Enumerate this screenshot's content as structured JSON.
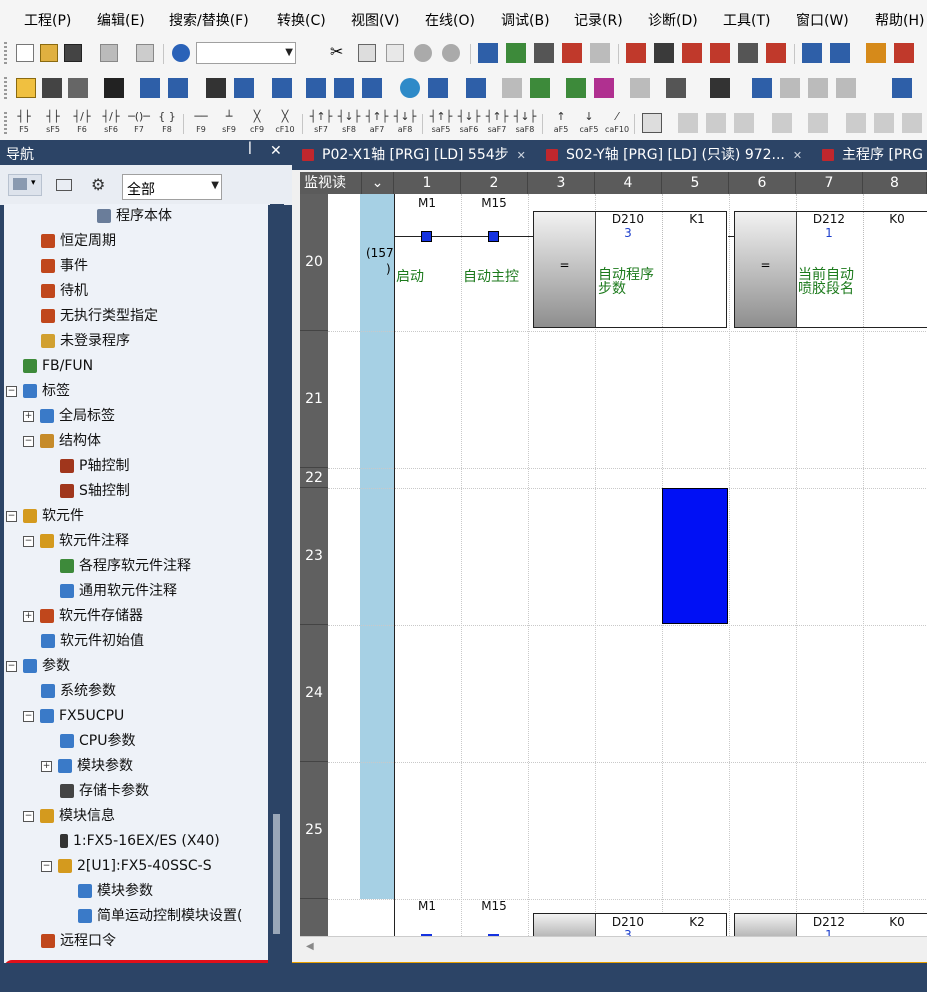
{
  "menu": [
    "工程(P)",
    "编辑(E)",
    "搜索/替换(F)",
    "转换(C)",
    "视图(V)",
    "在线(O)",
    "调试(B)",
    "记录(R)",
    "诊断(D)",
    "工具(T)",
    "窗口(W)",
    "帮助(H)"
  ],
  "fkeys": [
    {
      "sym": "┤├",
      "label": "F5"
    },
    {
      "sym": "┤├",
      "label": "sF5"
    },
    {
      "sym": "┤/├",
      "label": "F6"
    },
    {
      "sym": "┤/├",
      "label": "sF6"
    },
    {
      "sym": "─()─",
      "label": "F7"
    },
    {
      "sym": "{ }",
      "label": "F8"
    },
    {
      "sym": "──",
      "label": "F9"
    },
    {
      "sym": "┴",
      "label": "sF9"
    },
    {
      "sym": "╳",
      "label": "cF9"
    },
    {
      "sym": "╳",
      "label": "cF10"
    },
    {
      "sym": "┤↑├",
      "label": "sF7"
    },
    {
      "sym": "┤↓├",
      "label": "sF8"
    },
    {
      "sym": "┤↑├",
      "label": "aF7"
    },
    {
      "sym": "┤↓├",
      "label": "aF8"
    },
    {
      "sym": "┤↑├",
      "label": "saF5"
    },
    {
      "sym": "┤↓├",
      "label": "saF6"
    },
    {
      "sym": "┤↑├",
      "label": "saF7"
    },
    {
      "sym": "┤↓├",
      "label": "saF8"
    },
    {
      "sym": "↑",
      "label": "aF5"
    },
    {
      "sym": "↓",
      "label": "caF5"
    },
    {
      "sym": "⁄",
      "label": "caF10"
    }
  ],
  "nav": {
    "title": "导航",
    "pin": "ꟾ",
    "close": "✕",
    "filter": "全部",
    "items": [
      {
        "label": "程序本体",
        "exp": "",
        "color": "#6a7d9a"
      },
      {
        "label": "恒定周期",
        "exp": "",
        "color": "#c0471c"
      },
      {
        "label": "事件",
        "exp": "",
        "color": "#c0471c"
      },
      {
        "label": "待机",
        "exp": "",
        "color": "#c0471c"
      },
      {
        "label": "无执行类型指定",
        "exp": "",
        "color": "#c0471c"
      },
      {
        "label": "未登录程序",
        "exp": "",
        "color": "#d1a030"
      },
      {
        "label": "FB/FUN",
        "exp": "",
        "color": "#3d8a3a"
      },
      {
        "label": "标签",
        "exp": "−",
        "color": "#3a7ac8"
      },
      {
        "label": "全局标签",
        "exp": "+",
        "color": "#3a7ac8"
      },
      {
        "label": "结构体",
        "exp": "−",
        "color": "#c68b2a"
      },
      {
        "label": "P轴控制",
        "exp": "",
        "color": "#a0361c"
      },
      {
        "label": "S轴控制",
        "exp": "",
        "color": "#a0361c"
      },
      {
        "label": "软元件",
        "exp": "−",
        "color": "#d49a1e"
      },
      {
        "label": "软元件注释",
        "exp": "−",
        "color": "#d49a1e"
      },
      {
        "label": "各程序软元件注释",
        "exp": "",
        "color": "#3d8a3a"
      },
      {
        "label": "通用软元件注释",
        "exp": "",
        "color": "#3a7ac8"
      },
      {
        "label": "软元件存储器",
        "exp": "+",
        "color": "#c0471c"
      },
      {
        "label": "软元件初始值",
        "exp": "",
        "color": "#3a7ac8"
      },
      {
        "label": "参数",
        "exp": "−",
        "color": "#3a7ac8"
      },
      {
        "label": "系统参数",
        "exp": "",
        "color": "#3a7ac8"
      },
      {
        "label": "FX5UCPU",
        "exp": "−",
        "color": "#3a7ac8"
      },
      {
        "label": "CPU参数",
        "exp": "",
        "color": "#3a7ac8"
      },
      {
        "label": "模块参数",
        "exp": "+",
        "color": "#3a7ac8"
      },
      {
        "label": "存储卡参数",
        "exp": "",
        "color": "#444444"
      },
      {
        "label": "模块信息",
        "exp": "−",
        "color": "#d49a1e"
      },
      {
        "label": "1:FX5-16EX/ES  (X40)",
        "exp": "",
        "color": "#333333"
      },
      {
        "label": "2[U1]:FX5-40SSC-S",
        "exp": "−",
        "color": "#d49a1e"
      },
      {
        "label": "模块参数",
        "exp": "",
        "color": "#3a7ac8"
      },
      {
        "label": "简单运动控制模块设置(",
        "exp": "",
        "color": "#3a7ac8"
      },
      {
        "label": "远程口令",
        "exp": "",
        "color": "#c0471c"
      }
    ]
  },
  "tabs": [
    {
      "label": "P02-X1轴 [PRG] [LD] 554步"
    },
    {
      "label": "S02-Y轴 [PRG] [LD] (只读) 972..."
    },
    {
      "label": "主程序 [PRG"
    }
  ],
  "tab_close": "✕",
  "ladder": {
    "header_label": "监视读",
    "columns": [
      "1",
      "2",
      "3",
      "4",
      "5",
      "6",
      "7",
      "8"
    ],
    "rows": [
      "20",
      "21",
      "22",
      "23",
      "24",
      "25"
    ],
    "step": "(157",
    "step2": ")",
    "contacts": [
      {
        "device": "M1",
        "comment": "启动"
      },
      {
        "device": "M15",
        "comment": "自动主控"
      }
    ],
    "instr1": {
      "op": "=",
      "s1": "D210",
      "s1_val": "3",
      "s2": "K1",
      "comment1": "自动程序",
      "comment2": "步数"
    },
    "instr2": {
      "op": "=",
      "s1": "D212",
      "s1_val": "1",
      "s2": "K0",
      "comment1": "当前自动",
      "comment2": "喷胶段名"
    },
    "next": {
      "c1": "M1",
      "c2": "M15",
      "s1": "D210",
      "s1_val": "3",
      "s2": "K2",
      "s3": "D212",
      "s3_val": "1",
      "s4": "K0"
    }
  },
  "colors": {
    "accent": "#2c4466",
    "highlight_border": "#e0101a",
    "cell_blue": "#0010f5",
    "contact_blue": "#1432e0",
    "comment_green": "#1c7a1c"
  }
}
